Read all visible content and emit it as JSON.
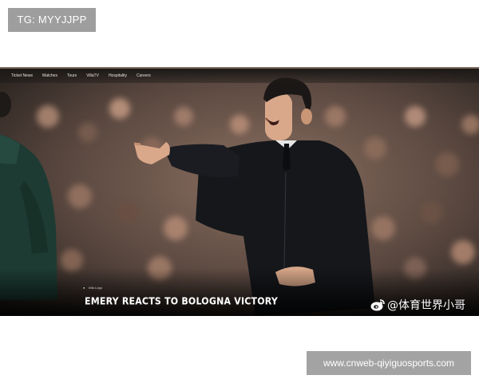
{
  "tg_badge": {
    "text": "TG: MYYJJPP"
  },
  "screenshot": {
    "nav": [
      "Ticket News",
      "Matches",
      "Tours",
      "VillaTV",
      "Hospitality",
      "Careers"
    ],
    "source_line": "Villa Logo",
    "headline": "EMERY REACTS TO BOLOGNA VICTORY",
    "watermark": {
      "icon": "weibo-icon",
      "text": "@体育世界小哥"
    }
  },
  "url_badge": {
    "text": "www.cnweb-qiyiguosports.com"
  },
  "colors": {
    "badge_bg": "#9e9e9e",
    "photo_bg": "#2b2622",
    "jacket": "#15171b",
    "skin": "#d9a88a",
    "crowd_warm": "#8a6a58"
  }
}
